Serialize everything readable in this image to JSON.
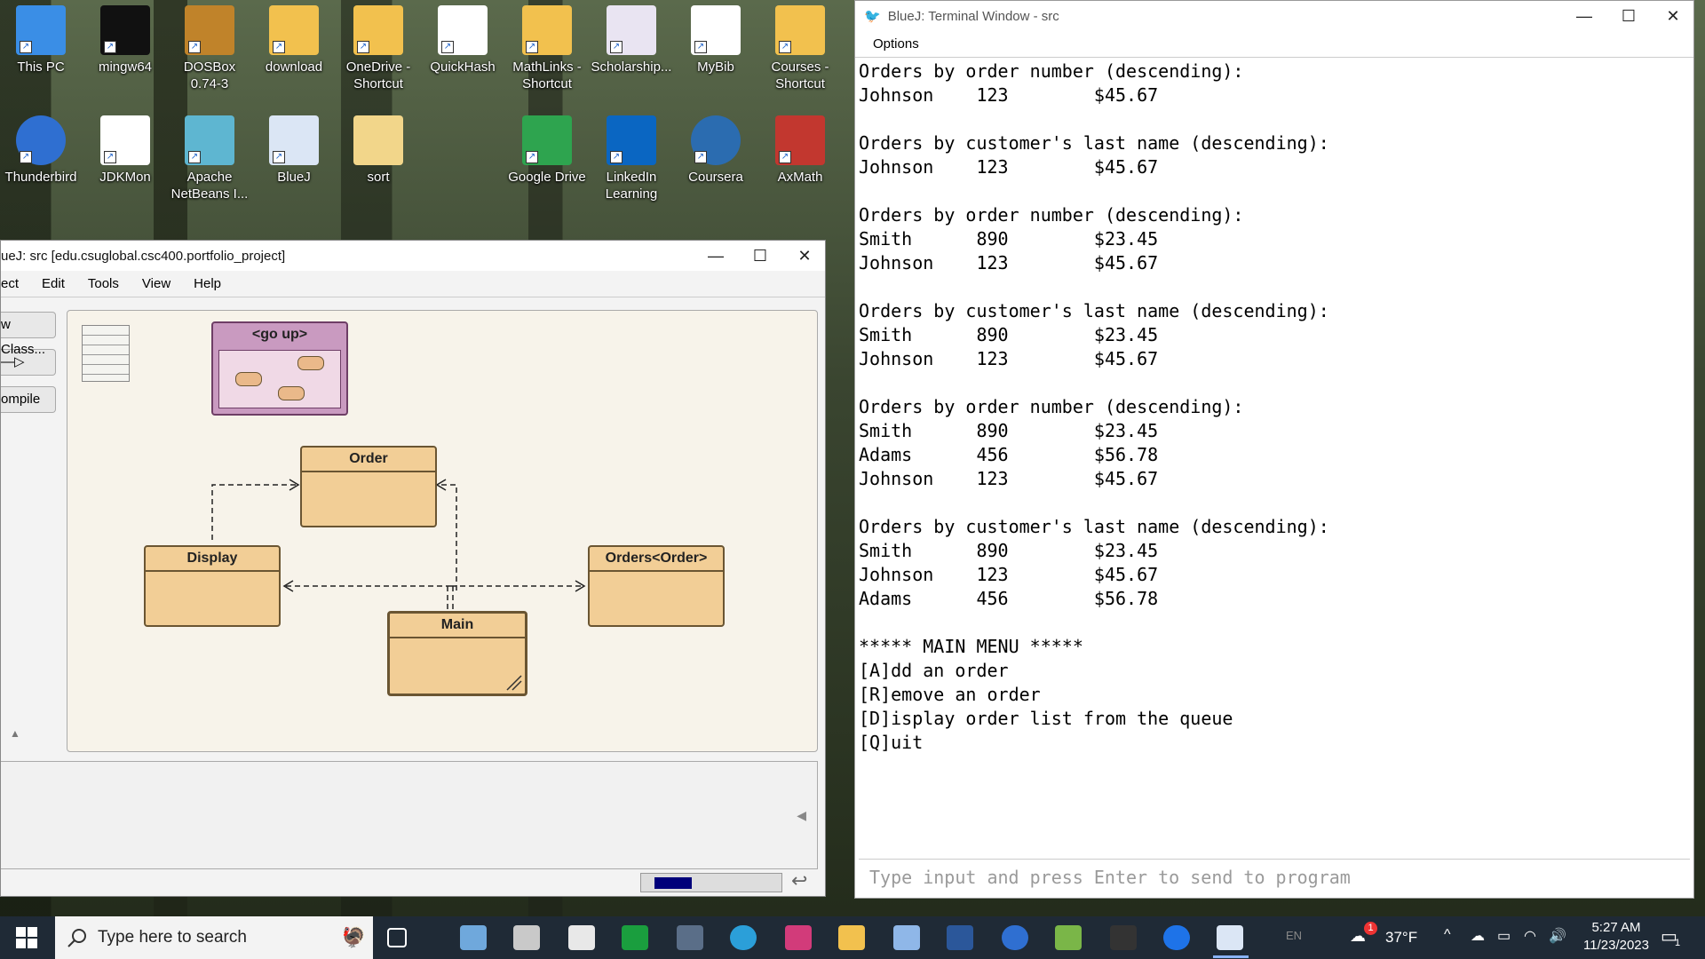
{
  "desktop": {
    "icons": [
      {
        "label": "This PC",
        "color": "#3a8ee6"
      },
      {
        "label": "mingw64",
        "color": "#111111"
      },
      {
        "label": "DOSBox 0.74-3",
        "color": "#c0832a"
      },
      {
        "label": "download",
        "color": "#f2c14e"
      },
      {
        "label": "OneDrive - Shortcut",
        "color": "#f2c14e"
      },
      {
        "label": "QuickHash",
        "color": "#ffffff"
      },
      {
        "label": "MathLinks - Shortcut",
        "color": "#f2c14e"
      },
      {
        "label": "Scholarship...",
        "color": "#e9e4f2"
      },
      {
        "label": "MyBib",
        "color": "#2c6bd8"
      },
      {
        "label": "Courses - Shortcut",
        "color": "#f2c14e"
      },
      {
        "label": "Thunderbird",
        "color": "#2f6fd1"
      },
      {
        "label": "JDKMon",
        "color": "#ffffff"
      },
      {
        "label": "Apache NetBeans I...",
        "color": "#5eb6d1"
      },
      {
        "label": "BlueJ",
        "color": "#dbe6f5"
      },
      {
        "label": "sort",
        "color": "#f2d68a"
      },
      {
        "label": "Google Drive",
        "color": "#2ea44f"
      },
      {
        "label": "LinkedIn Learning",
        "color": "#0a66c2"
      },
      {
        "label": "Coursera",
        "color": "#2b6cb0"
      },
      {
        "label": "AxMath",
        "color": "#c2372f"
      }
    ]
  },
  "bluej": {
    "title": "ueJ:  src  [edu.csuglobal.csc400.portfolio_project]",
    "menu": [
      "ect",
      "Edit",
      "Tools",
      "View",
      "Help"
    ],
    "left_buttons": [
      "w Class...",
      "—▷",
      "ompile"
    ],
    "package_label": "<go up>",
    "classes": {
      "order": "Order",
      "display": "Display",
      "orders": "Orders<Order>",
      "main": "Main"
    }
  },
  "terminal": {
    "title": "BlueJ: Terminal Window - src",
    "menu": "Options",
    "output": "Orders by order number (descending):\nJohnson    123        $45.67\n\nOrders by customer's last name (descending):\nJohnson    123        $45.67\n\nOrders by order number (descending):\nSmith      890        $23.45\nJohnson    123        $45.67\n\nOrders by customer's last name (descending):\nSmith      890        $23.45\nJohnson    123        $45.67\n\nOrders by order number (descending):\nSmith      890        $23.45\nAdams      456        $56.78\nJohnson    123        $45.67\n\nOrders by customer's last name (descending):\nSmith      890        $23.45\nJohnson    123        $45.67\nAdams      456        $56.78\n\n***** MAIN MENU *****\n[A]dd an order\n[R]emove an order\n[D]isplay order list from the queue\n[Q]uit",
    "input_placeholder": "Type input and press Enter to send to program"
  },
  "taskbar": {
    "search_placeholder": "Type here to search",
    "language": "EN",
    "weather": "37°F",
    "notification_badge": "1",
    "time": "5:27 AM",
    "date": "11/23/2023",
    "action_center_count": "1"
  }
}
